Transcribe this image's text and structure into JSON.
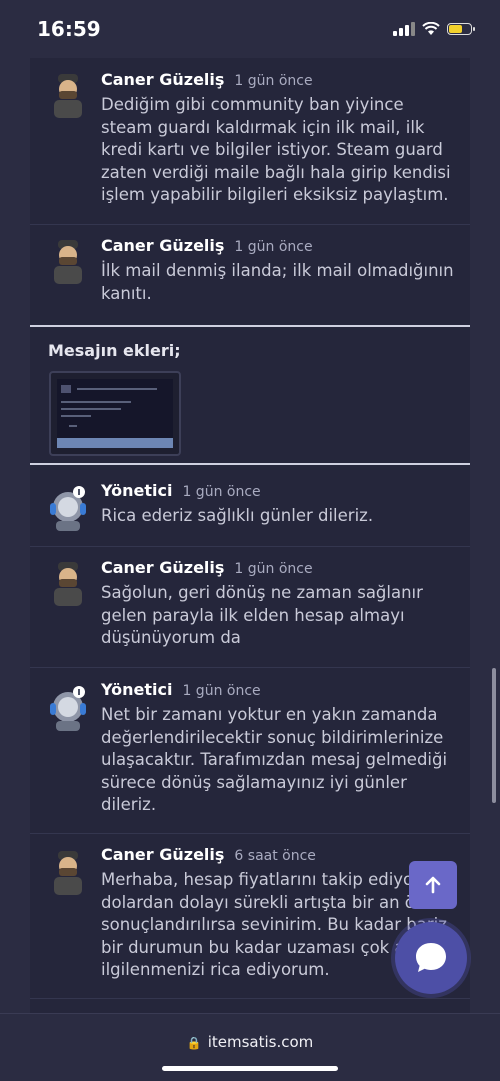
{
  "status_bar": {
    "time": "16:59"
  },
  "messages": [
    {
      "author": "Caner Güzeliş",
      "time": "1 gün önce",
      "text": "Dediğim gibi community ban yiyince steam guardı kaldırmak için ilk mail, ilk kredi kartı ve bilgiler istiyor. Steam guard zaten verdiği maile bağlı hala girip kendisi işlem yapabilir bilgileri eksiksiz paylaştım.",
      "avatar_icon": "user-avatar-icon"
    },
    {
      "author": "Caner Güzeliş",
      "time": "1 gün önce",
      "text": "İlk mail denmiş ilanda; ilk mail olmadığının kanıtı.",
      "avatar_icon": "user-avatar-icon"
    },
    {
      "author": "Yönetici",
      "time": "1 gün önce",
      "text": "Rica ederiz sağlıklı günler dileriz.",
      "avatar_icon": "admin-avatar-icon"
    },
    {
      "author": "Caner Güzeliş",
      "time": "1 gün önce",
      "text": "Sağolun, geri dönüş ne zaman sağlanır gelen parayla ilk elden hesap almayı düşünüyorum da",
      "avatar_icon": "user-avatar-icon"
    },
    {
      "author": "Yönetici",
      "time": "1 gün önce",
      "text": "Net bir zamanı yoktur en yakın zamanda değerlendirilecektir sonuç bildirimlerinize ulaşacaktır. Tarafımızdan mesaj gelmediği sürece dönüş sağlamayınız iyi günler dileriz.",
      "avatar_icon": "admin-avatar-icon"
    },
    {
      "author": "Caner Güzeliş",
      "time": "6 saat önce",
      "text": "Merhaba, hesap fiyatlarını takip ediyorum dolardan dolayı sürekli artışta bir an önce sonuçlandırılırsa sevinirim. Bu kadar bariz bir durumun bu kadar uzaması çok acil ilgilenmenizi rica ediyorum.",
      "avatar_icon": "user-avatar-icon"
    }
  ],
  "attachments": {
    "title": "Mesajın ekleri;"
  },
  "browser": {
    "url": "itemsatis.com"
  },
  "colors": {
    "background": "#2b2c42",
    "panel": "#25263b",
    "accent": "#6a68c8",
    "chat": "#4d4fa6"
  }
}
